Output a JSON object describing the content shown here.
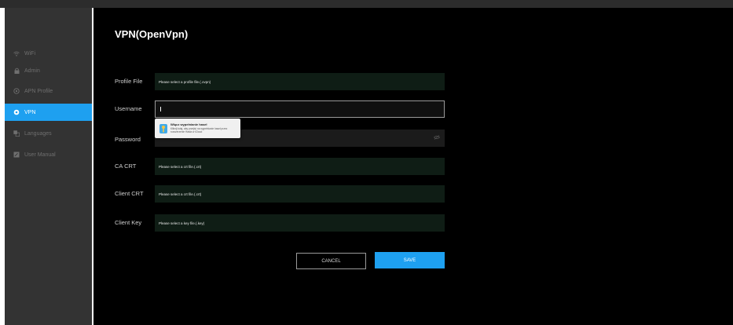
{
  "sidebar": {
    "items": [
      {
        "label": "WiFi",
        "icon": "wifi-icon",
        "active": false
      },
      {
        "label": "Admin",
        "icon": "lock-icon",
        "active": false
      },
      {
        "label": "APN Profile",
        "icon": "apn-icon",
        "active": false
      },
      {
        "label": "VPN",
        "icon": "vpn-icon",
        "active": true
      },
      {
        "label": "Languages",
        "icon": "languages-icon",
        "active": false
      },
      {
        "label": "User Manual",
        "icon": "manual-icon",
        "active": false
      }
    ]
  },
  "main": {
    "title": "VPN(OpenVpn)",
    "fields": {
      "profile_file": {
        "label": "Profile File",
        "value": "Please select a profile file.(.ovpn)"
      },
      "username": {
        "label": "Username",
        "value": ""
      },
      "password": {
        "label": "Password",
        "value": ""
      },
      "ca_crt": {
        "label": "CA CRT",
        "value": "Please select a crt file.(.crt)"
      },
      "client_crt": {
        "label": "Client CRT",
        "value": "Please select a crt file.(.crt)"
      },
      "client_key": {
        "label": "Client Key",
        "value": "Please select a key file.(.key)"
      }
    },
    "password_popup": {
      "title": "Włącz wypełnianie haseł",
      "description": "Kliknij tutaj, aby przejść na wypełnianie haseł przez rozszerzenie Hasła w iCloud"
    },
    "buttons": {
      "cancel": "CANCEL",
      "save": "SAVE"
    }
  },
  "colors": {
    "accent": "#1ea0f0",
    "sidebar": "#333333",
    "field": "#0f1d15",
    "background": "#000000"
  }
}
